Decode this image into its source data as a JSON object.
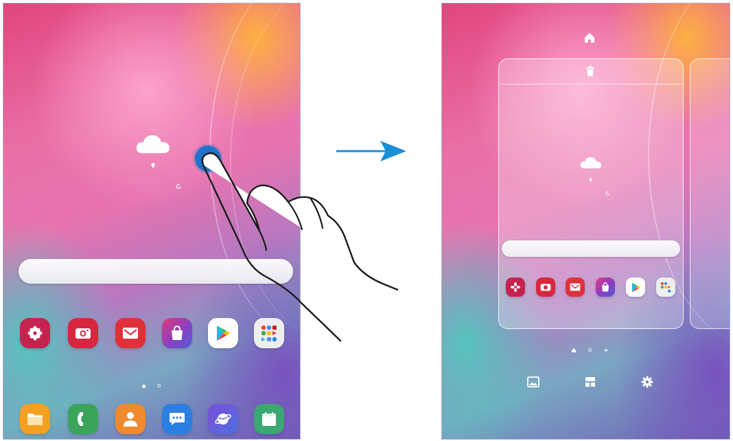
{
  "home_screen": {
    "apps_row": [
      {
        "icon": "gallery-icon",
        "color": "#c5234f"
      },
      {
        "icon": "camera-icon",
        "color": "#d8263f"
      },
      {
        "icon": "email-icon",
        "color": "#e0313b"
      },
      {
        "icon": "galaxy-store-icon",
        "color": "#8a3ec4"
      },
      {
        "icon": "play-store-icon",
        "color": "#ffffff"
      },
      {
        "icon": "google-folder-icon",
        "color": "#eeeeee"
      }
    ],
    "dock": [
      {
        "icon": "my-files-icon",
        "color": "#f4a020"
      },
      {
        "icon": "phone-icon",
        "color": "#3aa55a"
      },
      {
        "icon": "contacts-icon",
        "color": "#ef8a2e"
      },
      {
        "icon": "messages-icon",
        "color": "#2b7fe0"
      },
      {
        "icon": "internet-icon",
        "color": "#6a5ad8"
      },
      {
        "icon": "calendar-icon",
        "color": "#3aa870"
      }
    ],
    "page_indicator": {
      "count": 2,
      "active": 0
    }
  },
  "edit_mode": {
    "top_icons": [
      "home-icon",
      "trash-icon"
    ],
    "apps_row": [
      {
        "icon": "gallery-icon",
        "color": "#c5234f"
      },
      {
        "icon": "camera-icon",
        "color": "#d8263f"
      },
      {
        "icon": "email-icon",
        "color": "#e0313b"
      },
      {
        "icon": "galaxy-store-icon",
        "color": "#8a3ec4"
      },
      {
        "icon": "play-store-icon",
        "color": "#ffffff"
      },
      {
        "icon": "google-folder-icon",
        "color": "#eeeeee"
      }
    ],
    "page_indicator": {
      "count": 3,
      "active": 0
    },
    "bottom_options": [
      "wallpapers-icon",
      "widgets-icon",
      "settings-icon"
    ]
  },
  "colors": {
    "touch_point": "#1f73c8",
    "arrow": "#1a8fd6",
    "screen_border": "#a9b3c2"
  }
}
